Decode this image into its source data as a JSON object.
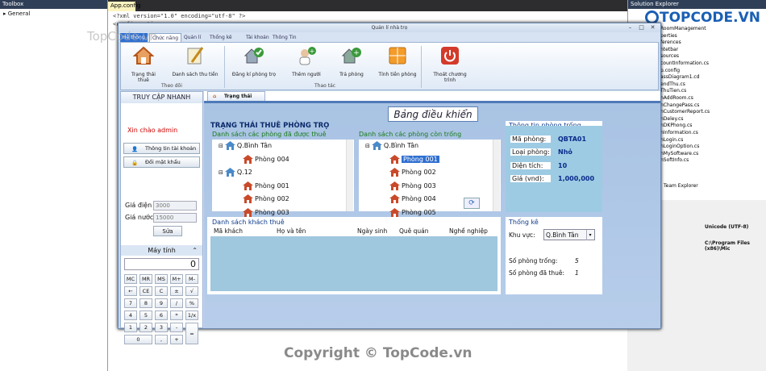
{
  "ide": {
    "toolbox_title": "Toolbox",
    "toolbox_item": "General",
    "editor_tab": "App.config",
    "code_lines": [
      "<?xml version=\"1.0\" encoding=\"utf-8\" ?>",
      "<configuration>"
    ],
    "solution_title": "Solution Explorer",
    "solution_items": [
      "RoomManagement",
      "perties",
      "ferences",
      "ntetbar",
      "sources",
      "countInformation.cs",
      "p.config",
      "assDiagram1.cd",
      "endThu.cs",
      "ThuTien.cs",
      "nAddRoom.cs",
      "nChangePass.cs",
      "nCustomerReport.cs",
      "nDeley.cs",
      "nDKPhong.cs",
      "nInformation.cs",
      "nLogin.cs",
      "nLoginOption.cs",
      "nMySoftware.cs",
      "nSoftInfo.cs"
    ],
    "team_explorer": "Team Explorer",
    "prop_encoding": "Unicode (UTF-8)",
    "prop_path": "C:\\Program Files (x86)\\Mic"
  },
  "brand": {
    "name": "TOPCODE.VN",
    "watermark_top": "TopCode.vn",
    "watermark_bottom": "Copyright © TopCode.vn"
  },
  "window": {
    "title": "Quản lí nhà trọ"
  },
  "menu": {
    "tabs": [
      "Hệ thống",
      "Chức năng",
      "Quản lí",
      "Thống kê",
      "Tài khoản",
      "Thông Tin"
    ]
  },
  "ribbon": {
    "buttons": [
      {
        "label": "Trạng thái thuê",
        "icon": "home-icon"
      },
      {
        "label": "Danh sách thu tiền",
        "icon": "edit-pen-icon"
      },
      {
        "label": "Đăng kí phòng trọ",
        "icon": "house-check-icon"
      },
      {
        "label": "Thêm người",
        "icon": "add-person-icon"
      },
      {
        "label": "Trả phòng",
        "icon": "house-add-icon"
      },
      {
        "label": "Tính tiền phòng",
        "icon": "calculator-icon"
      },
      {
        "label": "Thoát chương trình",
        "icon": "power-icon"
      }
    ],
    "group_theo_doi": "Theo dõi",
    "group_thao_tac": "Thao tác"
  },
  "sidebar": {
    "title": "TRUY CẬP NHANH",
    "greeting": "Xin chào admin",
    "btn_account": "Thông tin tài khoản",
    "btn_password": "Đổi mật khẩu",
    "electric_label": "Giá điện",
    "electric_value": "3000",
    "water_label": "Giá nước",
    "water_value": "15000",
    "edit_button": "Sửa",
    "calc_title": "Máy tính",
    "calc_display": "0",
    "calc_keys": [
      "MC",
      "MR",
      "MS",
      "M+",
      "M-",
      "←",
      "CE",
      "C",
      "±",
      "√",
      "7",
      "8",
      "9",
      "/",
      "%",
      "4",
      "5",
      "6",
      "*",
      "1/x",
      "1",
      "2",
      "3",
      "-",
      "=",
      "0",
      ",",
      "+"
    ]
  },
  "content": {
    "tab": "Trạng thái thuê",
    "dashboard_title": "Bảng điều khiển",
    "section_title": "TRẠNG THÁI THUÊ PHÒNG TRỌ",
    "rented_title": "Danh sách các phòng đã được thuê",
    "rented_tree": [
      {
        "label": "Q.Bình Tân",
        "level": 0
      },
      {
        "label": "Phòng 004",
        "level": 1
      },
      {
        "label": "Q.12",
        "level": 0
      },
      {
        "label": "Phòng 001",
        "level": 1
      },
      {
        "label": "Phòng 002",
        "level": 1
      },
      {
        "label": "Phòng 003",
        "level": 1
      }
    ],
    "free_title": "Danh sách các phòng còn trống",
    "free_tree": [
      {
        "label": "Q.Bình Tân",
        "level": 0
      },
      {
        "label": "Phòng 001",
        "level": 1,
        "selected": true
      },
      {
        "label": "Phòng 002",
        "level": 1
      },
      {
        "label": "Phòng 003",
        "level": 1
      },
      {
        "label": "Phòng 004",
        "level": 1
      },
      {
        "label": "Phòng 005",
        "level": 1
      }
    ],
    "room_info": {
      "title": "Thông tin phòng trống",
      "code_label": "Mã phòng:",
      "code_value": "QBTA01",
      "type_label": "Loại phòng:",
      "type_value": "Nhỏ",
      "area_label": "Diện tích:",
      "area_value": "10",
      "price_label": "Giá (vnd):",
      "price_value": "1,000,000"
    },
    "customers": {
      "title": "Danh sách khách thuê",
      "columns": [
        "Mã khách",
        "Họ và tên",
        "Ngày sinh",
        "Quê quán",
        "Nghề nghiệp"
      ]
    },
    "stats": {
      "title": "Thống kê",
      "area_label": "Khu vực:",
      "area_value": "Q.Bình Tân",
      "empty_label": "Số phòng trống:",
      "empty_value": "5",
      "rented_label": "Số phòng đã thuê:",
      "rented_value": "1"
    }
  }
}
